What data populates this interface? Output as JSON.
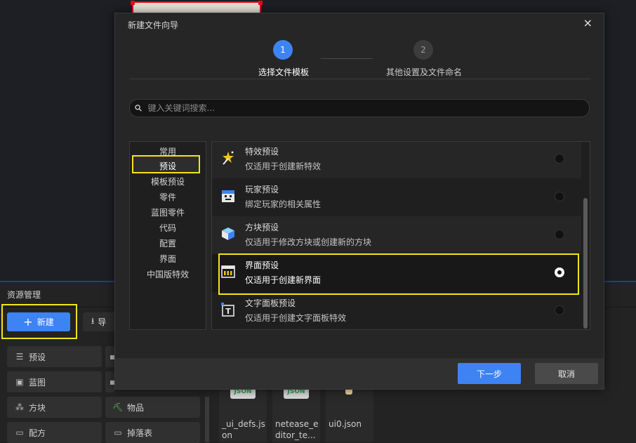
{
  "dialog": {
    "title": "新建文件向导",
    "close": "×",
    "steps": [
      {
        "number": "1",
        "label": "选择文件模板"
      },
      {
        "number": "2",
        "label": "其他设置及文件命名"
      }
    ],
    "search_placeholder": "键入关键词搜索...",
    "categories": [
      "常用",
      "预设",
      "模板预设",
      "零件",
      "蓝图零件",
      "代码",
      "配置",
      "界面",
      "中国版特效"
    ],
    "selected_category": "预设",
    "templates": [
      {
        "name": "特效预设",
        "desc": "仅适用于创建新特效",
        "icon": "effect-wand-icon",
        "selected": false
      },
      {
        "name": "玩家预设",
        "desc": "绑定玩家的相关属性",
        "icon": "player-icon",
        "selected": false
      },
      {
        "name": "方块预设",
        "desc": "仅适用于修改方块或创建新的方块",
        "icon": "block-cube-icon",
        "selected": false
      },
      {
        "name": "界面预设",
        "desc": "仅适用于创建新界面",
        "icon": "ui-window-icon",
        "selected": true
      },
      {
        "name": "文字面板预设",
        "desc": "仅适用于创建文字面板特效",
        "icon": "text-panel-icon",
        "selected": false
      }
    ],
    "next_label": "下一步",
    "cancel_label": "取消"
  },
  "asset_panel": {
    "title": "资源管理",
    "new_label": "新建",
    "import_label": "导",
    "categories": [
      {
        "label": "预设",
        "icon": "preset-icon"
      },
      {
        "label": "蓝图",
        "icon": "blueprint-icon"
      },
      {
        "label": "方块",
        "icon": "blocks-icon"
      },
      {
        "label": "物品",
        "icon": "pickaxe-icon"
      },
      {
        "label": "配方",
        "icon": "folder-icon"
      },
      {
        "label": "掉落表",
        "icon": "folder-icon"
      }
    ],
    "files": [
      {
        "label": "_ui_defs.json",
        "icon_text": "JSON"
      },
      {
        "label": "netease_editor_te...",
        "icon_text": "JSON"
      },
      {
        "label": "ui0.json",
        "icon_text": ""
      }
    ]
  },
  "colors": {
    "accent": "#3d83f3",
    "highlight": "#f4e31a",
    "selection_handle": "#e0101e"
  }
}
